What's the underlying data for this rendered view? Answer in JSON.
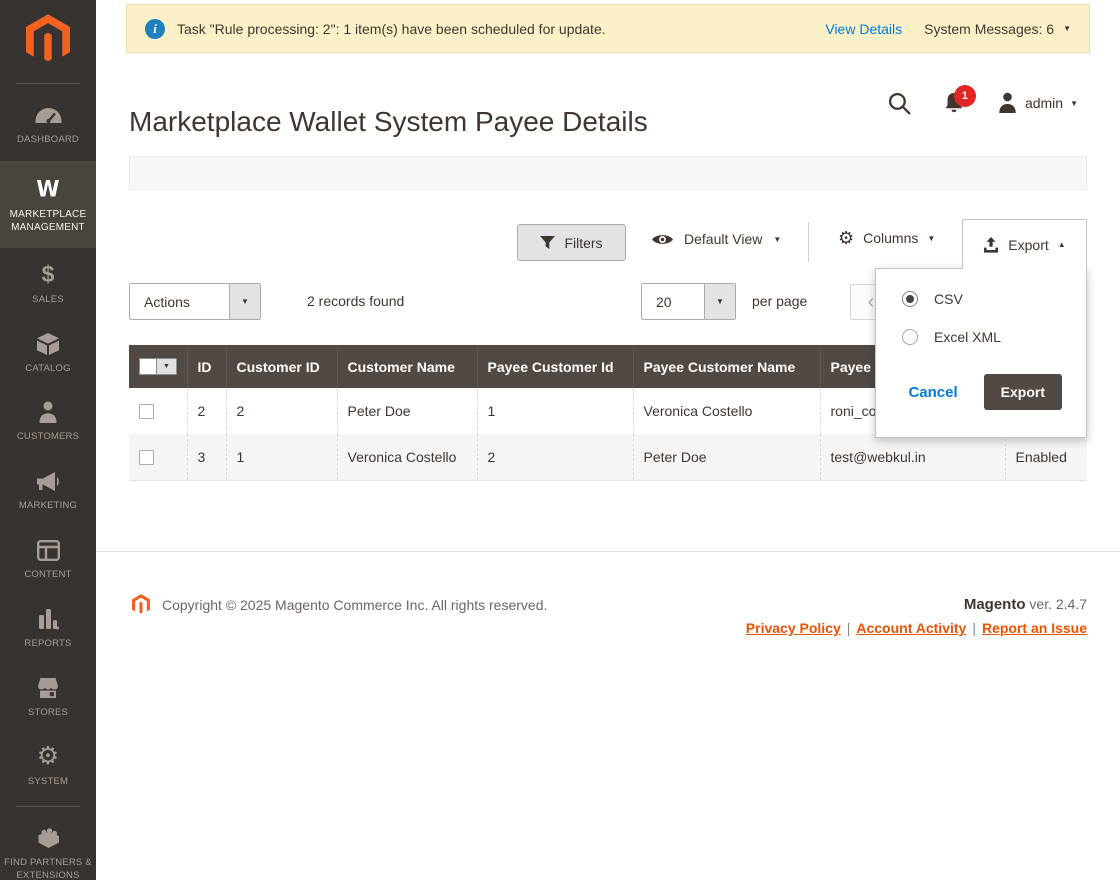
{
  "colors": {
    "accent": "#eb5202",
    "link": "#007bdb",
    "grid_header_bg": "#514943",
    "notification_badge": "#e22626",
    "sidebar_bg": "#373330",
    "message_bar_bg": "#fcf0c8"
  },
  "icons": {
    "caret_down": "▼",
    "caret_up": "▲",
    "chevron_left": "‹",
    "info": "i",
    "gear": "⚙",
    "marketplace_w": "W",
    "sales_dollar": "$"
  },
  "notification_bar": {
    "message": "Task \"Rule processing: 2\": 1 item(s) have been scheduled for update.",
    "view_details": "View Details",
    "system_messages": "System Messages: 6"
  },
  "sidebar": {
    "items": [
      {
        "label": "DASHBOARD"
      },
      {
        "label": "MARKETPLACE MANAGEMENT"
      },
      {
        "label": "SALES"
      },
      {
        "label": "CATALOG"
      },
      {
        "label": "CUSTOMERS"
      },
      {
        "label": "MARKETING"
      },
      {
        "label": "CONTENT"
      },
      {
        "label": "REPORTS"
      },
      {
        "label": "STORES"
      },
      {
        "label": "SYSTEM"
      },
      {
        "label": "FIND PARTNERS & EXTENSIONS"
      }
    ]
  },
  "header": {
    "title": "Marketplace Wallet System Payee Details",
    "notification_count": "1",
    "user": "admin"
  },
  "toolbar": {
    "filters_label": "Filters",
    "view_label": "Default View",
    "columns_label": "Columns",
    "export_label": "Export"
  },
  "export_dropdown": {
    "options": [
      {
        "label": "CSV",
        "selected": true
      },
      {
        "label": "Excel XML",
        "selected": false
      }
    ],
    "cancel_label": "Cancel",
    "export_label": "Export"
  },
  "actions_bar": {
    "actions_label": "Actions",
    "records_text": "2 records found",
    "per_page_value": "20",
    "per_page_label": "per page"
  },
  "table": {
    "headers": [
      "ID",
      "Customer ID",
      "Customer Name",
      "Payee Customer Id",
      "Payee Customer Name",
      "Payee",
      ""
    ],
    "rows": [
      {
        "cells": [
          "2",
          "2",
          "Peter Doe",
          "1",
          "Veronica Costello",
          "roni_co",
          ""
        ]
      },
      {
        "cells": [
          "3",
          "1",
          "Veronica Costello",
          "2",
          "Peter Doe",
          "test@webkul.in",
          "Enabled"
        ]
      }
    ]
  },
  "footer": {
    "copyright": "Copyright © 2025 Magento Commerce Inc. All rights reserved.",
    "brand": "Magento",
    "version": " ver. 2.4.7",
    "separator": "|",
    "links": [
      {
        "label": "Privacy Policy"
      },
      {
        "label": "Account Activity"
      },
      {
        "label": "Report an Issue"
      }
    ]
  }
}
